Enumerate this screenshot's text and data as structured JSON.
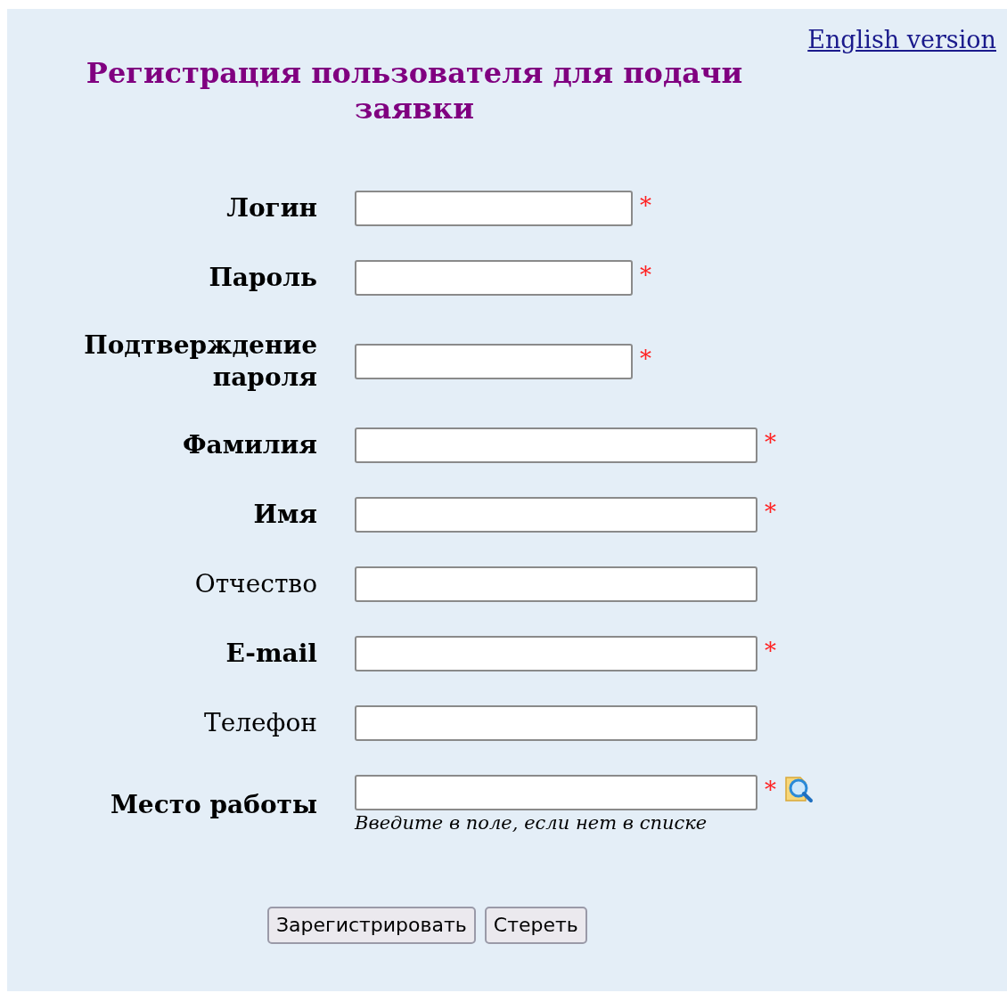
{
  "language_link": "English version",
  "title": "Регистрация пользователя для подачи заявки",
  "fields": [
    {
      "label": "Логин",
      "kind": "short",
      "required": true,
      "required_mark": "*"
    },
    {
      "label": "Пароль",
      "kind": "short",
      "required": true,
      "required_mark": "*"
    },
    {
      "label": "Подтверждение пароля",
      "kind": "short",
      "required": true,
      "required_mark": "*"
    },
    {
      "label": "Фамилия",
      "kind": "long",
      "required": true,
      "required_mark": "*"
    },
    {
      "label": "Имя",
      "kind": "long",
      "required": true,
      "required_mark": "*"
    },
    {
      "label": "Отчество",
      "kind": "long",
      "required": false
    },
    {
      "label": "E-mail",
      "kind": "long",
      "required": true,
      "required_mark": "*"
    },
    {
      "label": "Телефон",
      "kind": "long",
      "required": false
    },
    {
      "label": "Место работы",
      "kind": "lookup",
      "required": true,
      "required_mark": "*",
      "hint": "Введите в поле, если нет в списке"
    }
  ],
  "buttons": [
    "Зарегистрировать",
    "Стереть"
  ]
}
